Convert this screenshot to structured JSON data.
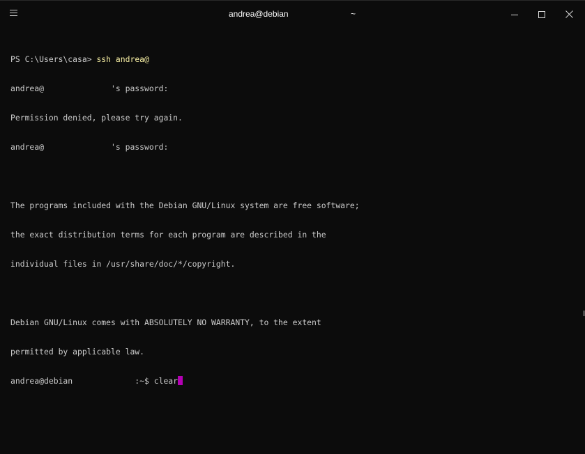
{
  "window": {
    "title": "andrea@debian",
    "title_suffix": "~",
    "menu_icon": "hamburger-icon",
    "controls": [
      "minimize-icon",
      "maximize-icon",
      "close-icon"
    ]
  },
  "terminal": {
    "lines": [
      {
        "prefix": "PS C:\\Users\\casa> ",
        "command": "ssh andrea@"
      },
      {
        "text": "andrea@              's password:"
      },
      {
        "text": "Permission denied, please try again."
      },
      {
        "text": "andrea@              's password:"
      },
      {
        "text": ""
      },
      {
        "text": "The programs included with the Debian GNU/Linux system are free software;"
      },
      {
        "text": "the exact distribution terms for each program are described in the"
      },
      {
        "text": "individual files in /usr/share/doc/*/copyright."
      },
      {
        "text": ""
      },
      {
        "text": "Debian GNU/Linux comes with ABSOLUTELY NO WARRANTY, to the extent"
      },
      {
        "text": "permitted by applicable law."
      }
    ],
    "prompt": "andrea@debian             :~$ ",
    "current_input": "clear",
    "colors": {
      "background": "#0c0c0c",
      "text": "#cccccc",
      "command": "#f9f1a5",
      "cursor": "#b400b4"
    }
  }
}
